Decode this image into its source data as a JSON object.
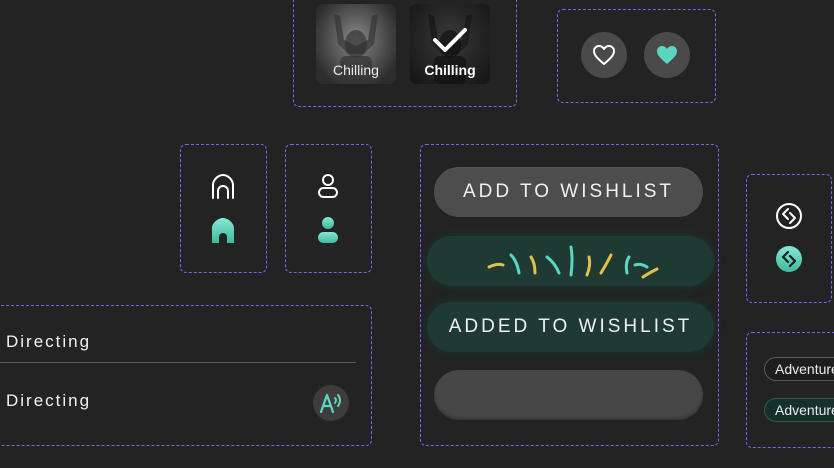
{
  "thumbnails": [
    {
      "label": "Chilling",
      "selected": false
    },
    {
      "label": "Chilling",
      "selected": true
    }
  ],
  "favorites": {
    "outline_icon": "heart-outline-icon",
    "filled_icon": "heart-filled-icon",
    "accent": "#5cd6c0"
  },
  "nav_icons": {
    "home_outline": "home-outline-icon",
    "home_filled": "home-filled-icon",
    "user_outline": "user-outline-icon",
    "user_filled": "user-filled-icon",
    "share_outline": "share-outline-icon",
    "share_filled": "share-filled-icon"
  },
  "wishlist": {
    "add_label": "ADD TO WISHLIST",
    "added_label": "ADDED TO WISHLIST",
    "green": "#1f3a33",
    "confetti_colors": [
      "#5cd6c0",
      "#e0c24a"
    ]
  },
  "directing": {
    "rows": [
      "Directing",
      "Directing"
    ],
    "avatar_icon": "text-to-speech-icon"
  },
  "chips": [
    "Adventure",
    "Adventure"
  ]
}
